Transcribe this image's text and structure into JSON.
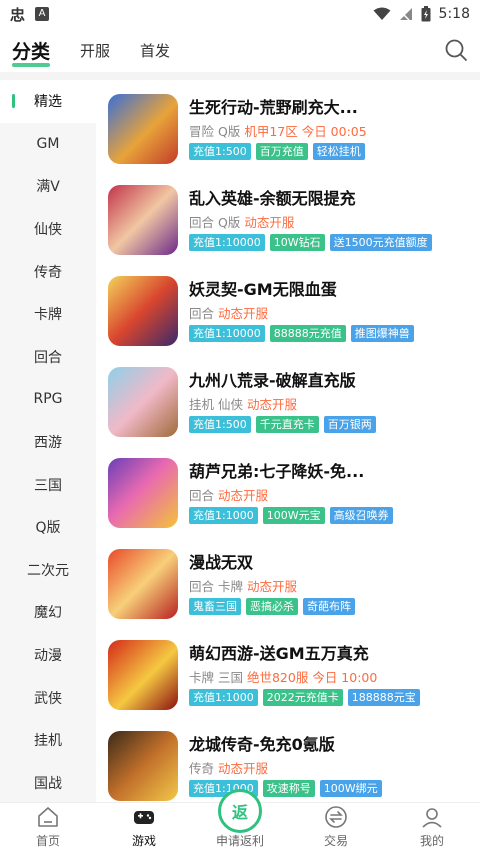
{
  "status_bar": {
    "time": "5:18",
    "app_glyph": "忠",
    "box_glyph": "A"
  },
  "header": {
    "tabs": [
      {
        "label": "分类"
      },
      {
        "label": "开服"
      },
      {
        "label": "首发"
      }
    ]
  },
  "sidebar": {
    "items": [
      {
        "label": "精选"
      },
      {
        "label": "GM"
      },
      {
        "label": "满V"
      },
      {
        "label": "仙侠"
      },
      {
        "label": "传奇"
      },
      {
        "label": "卡牌"
      },
      {
        "label": "回合"
      },
      {
        "label": "RPG"
      },
      {
        "label": "西游"
      },
      {
        "label": "三国"
      },
      {
        "label": "Q版"
      },
      {
        "label": "二次元"
      },
      {
        "label": "魔幻"
      },
      {
        "label": "动漫"
      },
      {
        "label": "武侠"
      },
      {
        "label": "挂机"
      },
      {
        "label": "国战"
      }
    ]
  },
  "games": [
    {
      "title": "生死行动-荒野刷充大...",
      "genre": "冒险 Q版",
      "highlight": "机甲17区 今日 00:05",
      "tags": [
        "充值1:500",
        "百万充值",
        "轻松挂机"
      ]
    },
    {
      "title": "乱入英雄-余额无限提充",
      "genre": "回合 Q版",
      "highlight": "动态开服",
      "tags": [
        "充值1:10000",
        "10W钻石",
        "送1500元充值额度"
      ]
    },
    {
      "title": "妖灵契-GM无限血蛋",
      "genre": "回合",
      "highlight": "动态开服",
      "tags": [
        "充值1:10000",
        "88888元充值",
        "推图爆神兽"
      ]
    },
    {
      "title": "九州八荒录-破解直充版",
      "genre": "挂机 仙侠",
      "highlight": "动态开服",
      "tags": [
        "充值1:500",
        "千元直充卡",
        "百万银两"
      ]
    },
    {
      "title": "葫芦兄弟:七子降妖-免...",
      "genre": "回合",
      "highlight": "动态开服",
      "tags": [
        "充值1:1000",
        "100W元宝",
        "高级召唤券"
      ]
    },
    {
      "title": "漫战无双",
      "genre": "回合 卡牌",
      "highlight": "动态开服",
      "tags": [
        "鬼畜三国",
        "恶搞必杀",
        "奇葩布阵"
      ]
    },
    {
      "title": "萌幻西游-送GM五万真充",
      "genre": "卡牌 三国",
      "highlight": "绝世820服 今日 10:00",
      "tags": [
        "充值1:1000",
        "2022元充值卡",
        "188888元宝"
      ]
    },
    {
      "title": "龙城传奇-免充0氪版",
      "genre": "传奇",
      "highlight": "动态开服",
      "tags": [
        "充值1:1000",
        "攻速称号",
        "100W绑元"
      ]
    }
  ],
  "bottom_nav": {
    "items": [
      {
        "label": "首页"
      },
      {
        "label": "游戏"
      },
      {
        "label": "申请返利",
        "badge": "返"
      },
      {
        "label": "交易"
      },
      {
        "label": "我的"
      }
    ]
  },
  "colors": {
    "accent": "#2ec27e",
    "highlight": "#ff6a3d"
  }
}
